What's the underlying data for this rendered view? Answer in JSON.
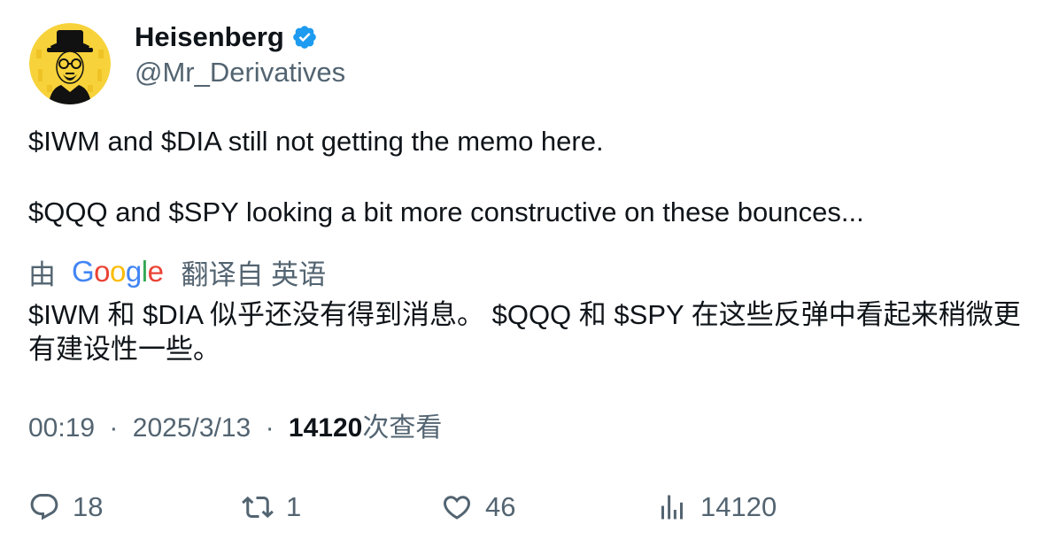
{
  "author": {
    "display_name": "Heisenberg",
    "handle": "@Mr_Derivatives",
    "verified": true,
    "verified_color": "#1d9bf0",
    "avatar_background": "#f7d23a"
  },
  "tweet": {
    "line1": "$IWM and $DIA still not getting the memo here.",
    "line2": "$QQQ and $SPY looking a bit more constructive on these bounces..."
  },
  "translation": {
    "by_label": "由",
    "google_letters": [
      "G",
      "o",
      "o",
      "g",
      "l",
      "e"
    ],
    "from_label": "翻译自 英语",
    "text": "$IWM 和 $DIA 似乎还没有得到消息。 $QQQ 和 $SPY 在这些反弹中看起来稍微更有建设性一些。"
  },
  "meta": {
    "time": "00:19",
    "separator": "·",
    "date": "2025/3/13",
    "views_count": "14120",
    "views_label": "次查看"
  },
  "actions": {
    "reply_count": "18",
    "retweet_count": "1",
    "like_count": "46",
    "views_count": "14120"
  },
  "icons": {
    "reply": "reply-icon",
    "retweet": "retweet-icon",
    "like": "heart-icon",
    "views": "analytics-icon",
    "verified": "verified-badge-icon"
  },
  "colors": {
    "text": "#0f1419",
    "secondary": "#536471",
    "google_blue": "#4285F4",
    "google_red": "#EA4335",
    "google_yellow": "#FBBC05",
    "google_green": "#34A853"
  }
}
